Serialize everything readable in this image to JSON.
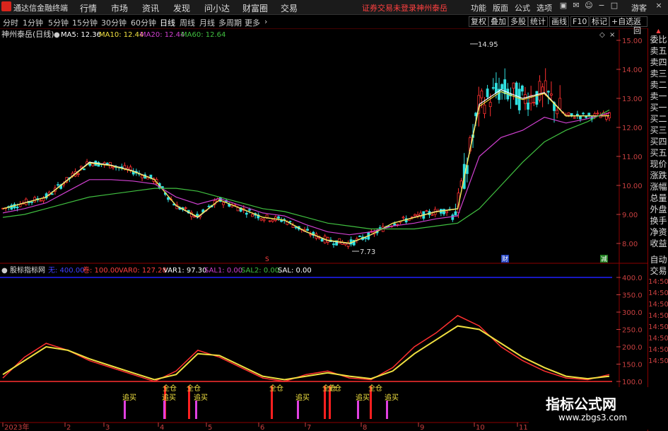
{
  "app": {
    "name": "通达信金融终端",
    "guest": "游客"
  },
  "menu": [
    "行情",
    "市场",
    "资讯",
    "发现",
    "问小达",
    "财富圈",
    "交易"
  ],
  "notice": {
    "warning": "证券交易未登录",
    "stock": "神州泰岳"
  },
  "right_menu": [
    "功能",
    "版面",
    "公式",
    "选项"
  ],
  "toolbar": {
    "periods": [
      "分时",
      "1分钟",
      "5分钟",
      "15分钟",
      "30分钟",
      "60分钟",
      "日线",
      "周线",
      "月线",
      "多周期",
      "更多"
    ],
    "selected": "日线",
    "right_buttons": [
      "复权",
      "叠加",
      "多股",
      "统计",
      "画线",
      "F10",
      "标记",
      "+自选",
      "返回"
    ]
  },
  "side_panel": [
    "委比",
    "卖五",
    "卖四",
    "卖三",
    "卖二",
    "卖一",
    "买一",
    "买二",
    "买三",
    "买四",
    "买五",
    "现价",
    "涨跌",
    "涨幅",
    "总量",
    "外盘",
    "换手",
    "净资",
    "收益"
  ],
  "side_lower": [
    "自动",
    "交易"
  ],
  "main_legend": {
    "title": "神州泰岳(日线)",
    "items": [
      {
        "label": "MA5: 12.36",
        "color": "#ffffff"
      },
      {
        "label": "MA10: 12.44",
        "color": "#f0e040"
      },
      {
        "label": "MA20: 12.44",
        "color": "#d040d0"
      },
      {
        "label": "MA60: 12.64",
        "color": "#40c040"
      }
    ]
  },
  "indicator_legend": {
    "title": "股标指标网",
    "items": [
      {
        "label": "无: 400.00",
        "color": "#4040ff"
      },
      {
        "label": "卷: 100.00",
        "color": "#ff4040"
      },
      {
        "label": "VAR0: 127.28",
        "color": "#ff4040"
      },
      {
        "label": "VAR1: 97.30",
        "color": "#ffffff"
      },
      {
        "label": "SAL1: 0.00",
        "color": "#d040d0"
      },
      {
        "label": "SAL2: 0.00",
        "color": "#40c040"
      },
      {
        "label": "SAL: 0.00",
        "color": "#ffffff"
      }
    ]
  },
  "price_axis": [
    "15.00",
    "14.00",
    "13.00",
    "12.00",
    "11.00",
    "10.00",
    "9.00",
    "8.00"
  ],
  "indicator_axis": [
    "400.0",
    "350.0",
    "300.0",
    "250.0",
    "200.0",
    "150.0",
    "100.0"
  ],
  "time_axis_right": [
    "14:50",
    "14:50",
    "14:50",
    "14:50",
    "14:50",
    "14:50",
    "14:50",
    "14:50"
  ],
  "date_axis": [
    "2023年",
    "2",
    "3",
    "4",
    "5",
    "6",
    "7",
    "8",
    "9",
    "10",
    "11"
  ],
  "annotations": {
    "high": "14.95",
    "low": "7.73",
    "markers": [
      {
        "label": "追买"
      },
      {
        "label": "全仓"
      },
      {
        "label": "全仓"
      },
      {
        "label": "追买"
      },
      {
        "label": "全仓"
      },
      {
        "label": "追买"
      },
      {
        "label": "全仓"
      },
      {
        "label": "全仓"
      },
      {
        "label": "追买"
      },
      {
        "label": "全仓"
      },
      {
        "label": "追买"
      },
      {
        "label": "追买"
      }
    ],
    "tags": [
      "S",
      "财",
      "减"
    ]
  },
  "watermark": {
    "title": "指标公式网",
    "url": "www.zbgs3.com"
  },
  "chart_data": [
    {
      "type": "candlestick",
      "title": "神州泰岳(日线)",
      "y_range": [
        7.5,
        15.2
      ],
      "series": [
        {
          "name": "MA5",
          "values": [
            9.2,
            9.4,
            9.6,
            10.2,
            10.8,
            10.7,
            10.5,
            10.2,
            9.3,
            8.9,
            9.5,
            9.2,
            8.9,
            8.8,
            8.4,
            8.1,
            8.0,
            8.3,
            8.7,
            8.9,
            9.1,
            9.2,
            12.8,
            13.3,
            13.0,
            13.2,
            12.4,
            12.4,
            12.4
          ]
        },
        {
          "name": "MA60",
          "values": [
            8.9,
            9.0,
            9.2,
            9.4,
            9.6,
            9.7,
            9.8,
            9.9,
            9.9,
            9.8,
            9.6,
            9.4,
            9.2,
            9.1,
            8.9,
            8.7,
            8.6,
            8.5,
            8.5,
            8.5,
            8.6,
            8.7,
            9.2,
            10.0,
            10.8,
            11.5,
            11.9,
            12.2,
            12.6
          ]
        }
      ],
      "high": 14.95,
      "low": 7.73
    },
    {
      "type": "line",
      "title": "股标指标网",
      "y_range": [
        90,
        410
      ],
      "series": [
        {
          "name": "VAR0",
          "values": [
            110,
            170,
            210,
            190,
            160,
            140,
            120,
            100,
            130,
            190,
            170,
            140,
            110,
            100,
            120,
            130,
            110,
            105,
            140,
            200,
            240,
            290,
            260,
            200,
            160,
            130,
            110,
            105,
            120
          ]
        },
        {
          "name": "VAR1",
          "values": [
            120,
            160,
            200,
            190,
            165,
            145,
            125,
            105,
            120,
            180,
            175,
            145,
            115,
            105,
            115,
            125,
            115,
            108,
            130,
            180,
            220,
            260,
            250,
            210,
            170,
            140,
            115,
            108,
            115
          ]
        }
      ]
    }
  ]
}
